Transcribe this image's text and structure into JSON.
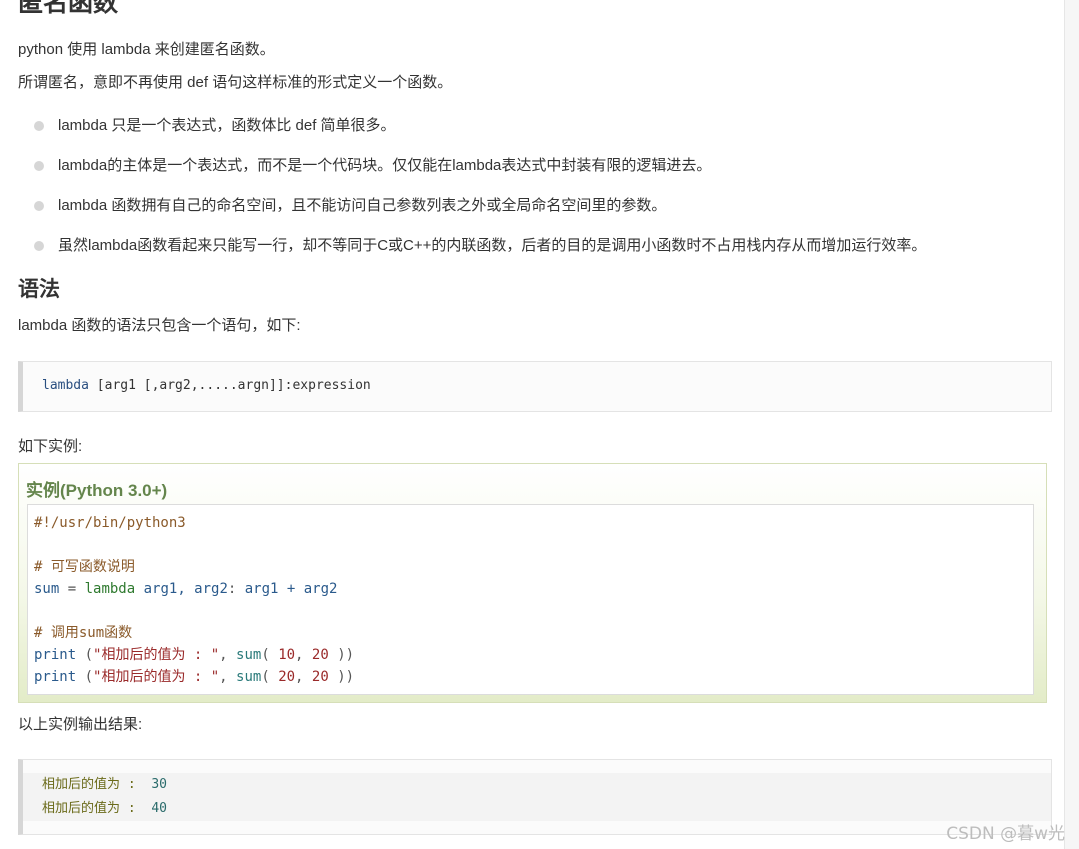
{
  "title": "匿名函数",
  "intro": [
    "python 使用 lambda 来创建匿名函数。",
    "所谓匿名，意即不再使用 def 语句这样标准的形式定义一个函数。"
  ],
  "bullets": [
    "lambda 只是一个表达式，函数体比 def 简单很多。",
    "lambda的主体是一个表达式，而不是一个代码块。仅仅能在lambda表达式中封装有限的逻辑进去。",
    "lambda 函数拥有自己的命名空间，且不能访问自己参数列表之外或全局命名空间里的参数。",
    "虽然lambda函数看起来只能写一行，却不等同于C或C++的内联函数，后者的目的是调用小函数时不占用栈内存从而增加运行效率。"
  ],
  "syntax": {
    "heading": "语法",
    "desc": "lambda 函数的语法只包含一个语句，如下:",
    "code_keyword": "lambda",
    "code_rest": " [arg1 [,arg2,.....argn]]:expression"
  },
  "example": {
    "lead": "如下实例:",
    "title": "实例(Python 3.0+)",
    "shebang": "#!/usr/bin/python3",
    "comment1": "# 可写函数说明",
    "line_sum": {
      "name": "sum",
      "eq": " = ",
      "kw": "lambda",
      "args": " arg1, arg2",
      "colon": ": ",
      "expr": "arg1 + arg2"
    },
    "comment2": "# 调用sum函数",
    "print_lines": [
      {
        "fn": "print",
        "open": " (",
        "str": "\"相加后的值为 : \"",
        "sep": ", ",
        "call": "sum",
        "args_open": "( ",
        "a": "10",
        "comma": ", ",
        "b": "20",
        "close": " ))"
      },
      {
        "fn": "print",
        "open": " (",
        "str": "\"相加后的值为 : \"",
        "sep": ", ",
        "call": "sum",
        "args_open": "( ",
        "a": "20",
        "comma": ", ",
        "b": "20",
        "close": " ))"
      }
    ]
  },
  "output": {
    "lead": "以上实例输出结果:",
    "lines": [
      {
        "label": "相加后的值为 :  ",
        "value": "30"
      },
      {
        "label": "相加后的值为 :  ",
        "value": "40"
      }
    ]
  },
  "watermark": "CSDN @暮w光"
}
